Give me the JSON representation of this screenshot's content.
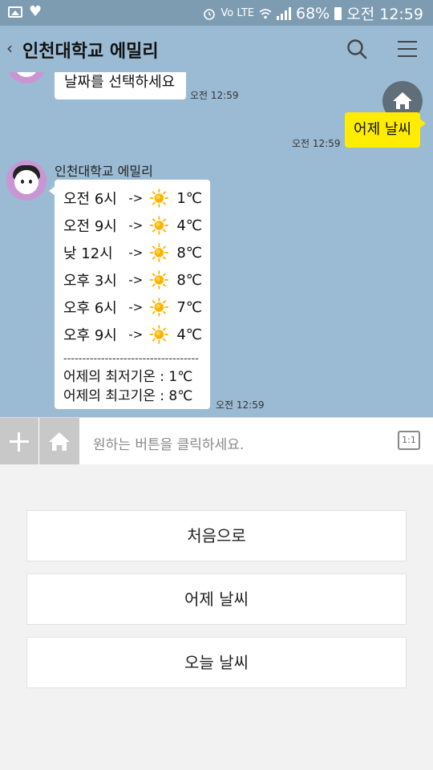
{
  "status_bar": {
    "battery": "68%",
    "time": "오전 12:59",
    "network": "Vo LTE"
  },
  "header": {
    "title": "인천대학교 에밀리"
  },
  "messages": [
    {
      "type": "bot",
      "text": "날짜를 선택하세요",
      "time": "오전 12:59"
    },
    {
      "type": "user",
      "text": "어제 날씨",
      "time": "오전 12:59"
    },
    {
      "type": "bot",
      "sender": "인천대학교 에밀리",
      "time": "오전 12:59",
      "forecast": [
        {
          "label": "오전 6시",
          "arrow": "->",
          "icon": "sun-icon",
          "temp": "1℃"
        },
        {
          "label": "오전 9시",
          "arrow": "->",
          "icon": "sun-icon",
          "temp": "4℃"
        },
        {
          "label": "낮 12시",
          "arrow": "->",
          "icon": "sun-icon",
          "temp": "8℃"
        },
        {
          "label": "오후 3시",
          "arrow": "->",
          "icon": "sun-icon",
          "temp": "8℃"
        },
        {
          "label": "오후 6시",
          "arrow": "->",
          "icon": "sun-icon",
          "temp": "7℃"
        },
        {
          "label": "오후 9시",
          "arrow": "->",
          "icon": "sun-icon",
          "temp": "4℃"
        }
      ],
      "divider": "------------------------------------",
      "min_line": "어제의 최저기온 : 1℃",
      "max_line": "어제의 최고기온 : 8℃"
    }
  ],
  "input": {
    "placeholder": "원하는 버튼을 클릭하세요.",
    "one_to_one": "1:1"
  },
  "quick_buttons": [
    "처음으로",
    "어제 날씨",
    "오늘 날씨"
  ],
  "colors": {
    "chat_bg": "#9bbbd4",
    "user_bubble": "#ffec00",
    "status_bar": "#7d9bb1"
  }
}
